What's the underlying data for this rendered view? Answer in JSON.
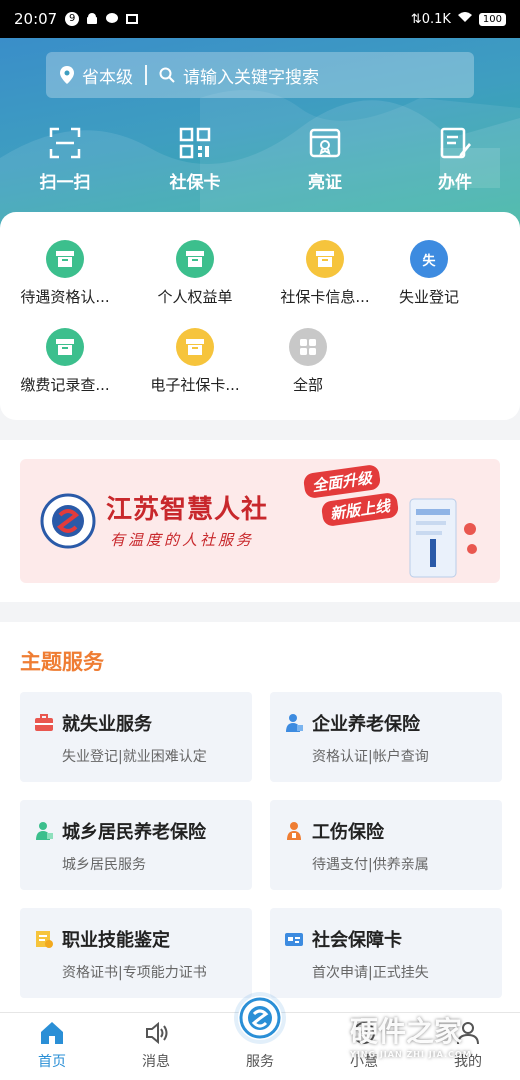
{
  "status_bar": {
    "time": "20:07",
    "notif_badge": "9",
    "net_speed": "0.1K",
    "battery": "100"
  },
  "search": {
    "location": "省本级",
    "placeholder": "请输入关键字搜索"
  },
  "quick_actions": [
    {
      "label": "扫一扫",
      "icon": "scan-icon"
    },
    {
      "label": "社保卡",
      "icon": "qr-code-icon"
    },
    {
      "label": "亮证",
      "icon": "certificate-icon"
    },
    {
      "label": "办件",
      "icon": "document-edit-icon"
    }
  ],
  "services": [
    {
      "label": "待遇资格认...",
      "icon": "box-icon",
      "color": "#3cbf8d"
    },
    {
      "label": "个人权益单",
      "icon": "box-icon",
      "color": "#3cbf8d"
    },
    {
      "label": "社保卡信息...",
      "icon": "box-icon",
      "color": "#f6c43c"
    },
    {
      "label": "失业登记",
      "icon": "shield-icon",
      "color": "#3d8be0",
      "glyph": "失"
    },
    {
      "label": "缴费记录查...",
      "icon": "box-icon",
      "color": "#3cbf8d"
    },
    {
      "label": "电子社保卡...",
      "icon": "box-icon",
      "color": "#f6c43c"
    },
    {
      "label": "全部",
      "icon": "grid-icon",
      "color": "#c8c8c8"
    }
  ],
  "banner": {
    "title": "江苏智慧人社",
    "subtitle": "有温度的人社服务",
    "tag1": "全面升级",
    "tag2": "新版上线"
  },
  "theme_services": {
    "heading": "主题服务",
    "cards": [
      {
        "title": "就失业服务",
        "subtitle": "失业登记|就业困难认定",
        "icon": "briefcase-icon",
        "color": "#e9574f"
      },
      {
        "title": "企业养老保险",
        "subtitle": "资格认证|帐户查询",
        "icon": "elder-icon",
        "color": "#3d8be0"
      },
      {
        "title": "城乡居民养老保险",
        "subtitle": "城乡居民服务",
        "icon": "elder-icon",
        "color": "#3cbf8d"
      },
      {
        "title": "工伤保险",
        "subtitle": "待遇支付|供养亲属",
        "icon": "worker-icon",
        "color": "#ef7d33"
      },
      {
        "title": "职业技能鉴定",
        "subtitle": "资格证书|专项能力证书",
        "icon": "certificate-icon",
        "color": "#f6c43c"
      },
      {
        "title": "社会保障卡",
        "subtitle": "首次申请|正式挂失",
        "icon": "card-icon",
        "color": "#3d8be0"
      }
    ]
  },
  "tabbar": [
    {
      "label": "首页",
      "icon": "home-icon",
      "active": true
    },
    {
      "label": "消息",
      "icon": "speaker-icon",
      "active": false
    },
    {
      "label": "服务",
      "icon": "logo-icon",
      "active": false
    },
    {
      "label": "小慧",
      "icon": "bot-icon",
      "active": false
    },
    {
      "label": "我的",
      "icon": "user-icon",
      "active": false
    }
  ],
  "watermark": {
    "text": "硬件之家",
    "sub": "YING JIAN ZHI JIA.COM"
  }
}
